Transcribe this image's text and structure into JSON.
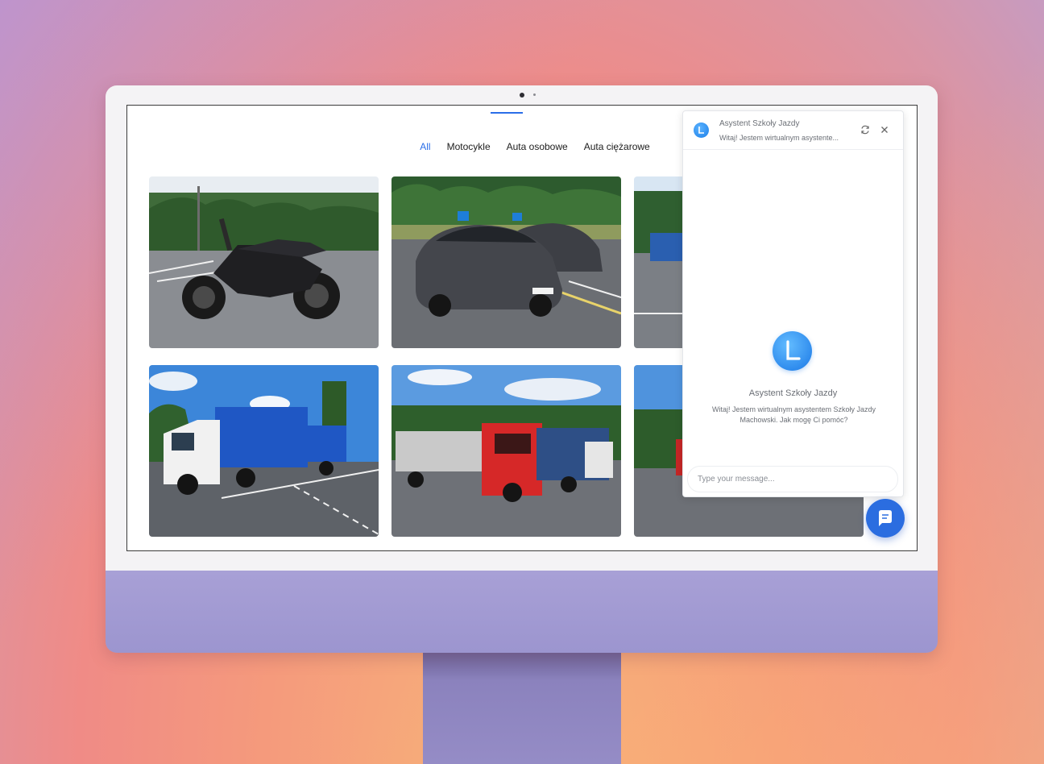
{
  "filters": {
    "items": [
      {
        "label": "All",
        "active": true
      },
      {
        "label": "Motocykle",
        "active": false
      },
      {
        "label": "Auta osobowe",
        "active": false
      },
      {
        "label": "Auta ciężarowe",
        "active": false
      }
    ]
  },
  "gallery": {
    "items": [
      {
        "subject": "motorcycle",
        "category": "Motocykle"
      },
      {
        "subject": "cars",
        "category": "Auta osobowe"
      },
      {
        "subject": "trailer",
        "category": "Auta ciężarowe"
      },
      {
        "subject": "truck-blue",
        "category": "Auta ciężarowe"
      },
      {
        "subject": "trucks-red-blue",
        "category": "Auta ciężarowe"
      },
      {
        "subject": "truck-partial",
        "category": "Auta ciężarowe"
      }
    ]
  },
  "chat": {
    "title": "Asystent Szkoły Jazdy",
    "subtitle": "Witaj! Jestem wirtualnym asystente...",
    "name": "Asystent Szkoły Jazdy",
    "greeting": "Witaj! Jestem wirtualnym asystentem Szkoły Jazdy Machowski. Jak mogę Ci pomóc?",
    "input_placeholder": "Type your message...",
    "refresh_icon": "refresh-icon",
    "close_icon": "close-icon",
    "launcher_icon": "chat-bubble-icon"
  },
  "colors": {
    "accent": "#2a6ee8",
    "chin": "#a8a0d6"
  }
}
